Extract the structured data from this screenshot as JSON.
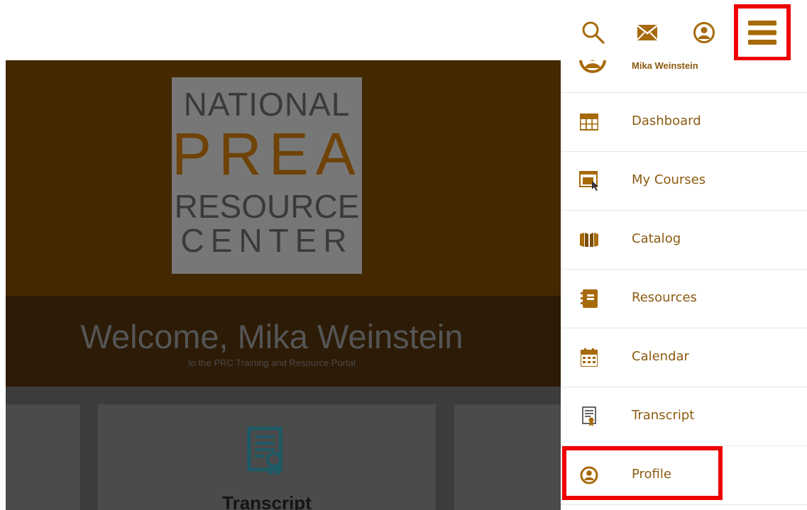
{
  "colors": {
    "accent": "#a66a0a",
    "menu_text": "#8c5a10",
    "highlight": "#ee0000",
    "hero_bg": "#432800",
    "overlay_dark": "#2c1b06"
  },
  "header": {
    "icons": [
      "search-icon",
      "mail-icon",
      "account-icon",
      "hamburger-menu-icon"
    ]
  },
  "hero": {
    "logo_lines": [
      "NATIONAL",
      "PREA",
      "RESOURCE",
      "CENTER"
    ],
    "welcome_title": "Welcome, Mika Weinstein",
    "welcome_subtitle": "to the PRC Training and Resource Portal"
  },
  "cards": {
    "visible_label": "Transcript"
  },
  "menu": {
    "user_name": "Mika Weinstein",
    "items": [
      {
        "label": "Dashboard",
        "icon": "dashboard-icon"
      },
      {
        "label": "My Courses",
        "icon": "my-courses-icon"
      },
      {
        "label": "Catalog",
        "icon": "catalog-icon"
      },
      {
        "label": "Resources",
        "icon": "resources-icon"
      },
      {
        "label": "Calendar",
        "icon": "calendar-icon"
      },
      {
        "label": "Transcript",
        "icon": "transcript-icon"
      },
      {
        "label": "Profile",
        "icon": "profile-icon"
      }
    ]
  }
}
